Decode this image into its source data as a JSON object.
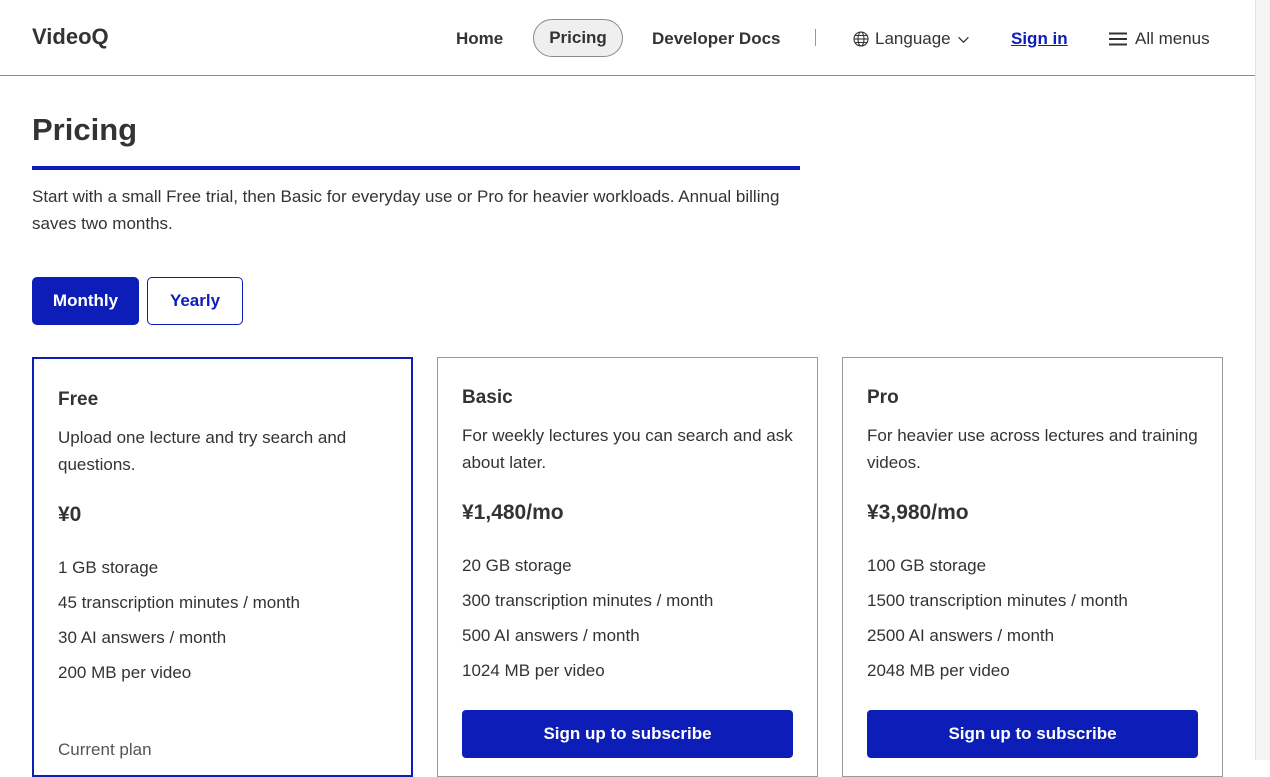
{
  "header": {
    "brand": "VideoQ",
    "nav": {
      "home": "Home",
      "pricing": "Pricing",
      "docs": "Developer Docs"
    },
    "language_label": "Language",
    "signin_label": "Sign in",
    "all_menus_label": "All menus"
  },
  "page": {
    "title": "Pricing",
    "intro": "Start with a small Free trial, then Basic for everyday use or Pro for heavier workloads. Annual billing saves two months."
  },
  "billing_toggle": {
    "monthly": "Monthly",
    "yearly": "Yearly",
    "selected": "Monthly"
  },
  "plans": [
    {
      "name": "Free",
      "description": "Upload one lecture and try search and questions.",
      "price": "¥0",
      "features": [
        "1 GB storage",
        "45 transcription minutes / month",
        "30 AI answers / month",
        "200 MB per video"
      ],
      "status": "Current plan"
    },
    {
      "name": "Basic",
      "description": "For weekly lectures you can search and ask about later.",
      "price": "¥1,480/mo",
      "features": [
        "20 GB storage",
        "300 transcription minutes / month",
        "500 AI answers / month",
        "1024 MB per video"
      ],
      "cta": "Sign up to subscribe"
    },
    {
      "name": "Pro",
      "description": "For heavier use across lectures and training videos.",
      "price": "¥3,980/mo",
      "features": [
        "100 GB storage",
        "1500 transcription minutes / month",
        "2500 AI answers / month",
        "2048 MB per video"
      ],
      "cta": "Sign up to subscribe"
    }
  ],
  "colors": {
    "accent": "#0d1eb8",
    "text": "#333333",
    "border": "#9a9a9a"
  }
}
